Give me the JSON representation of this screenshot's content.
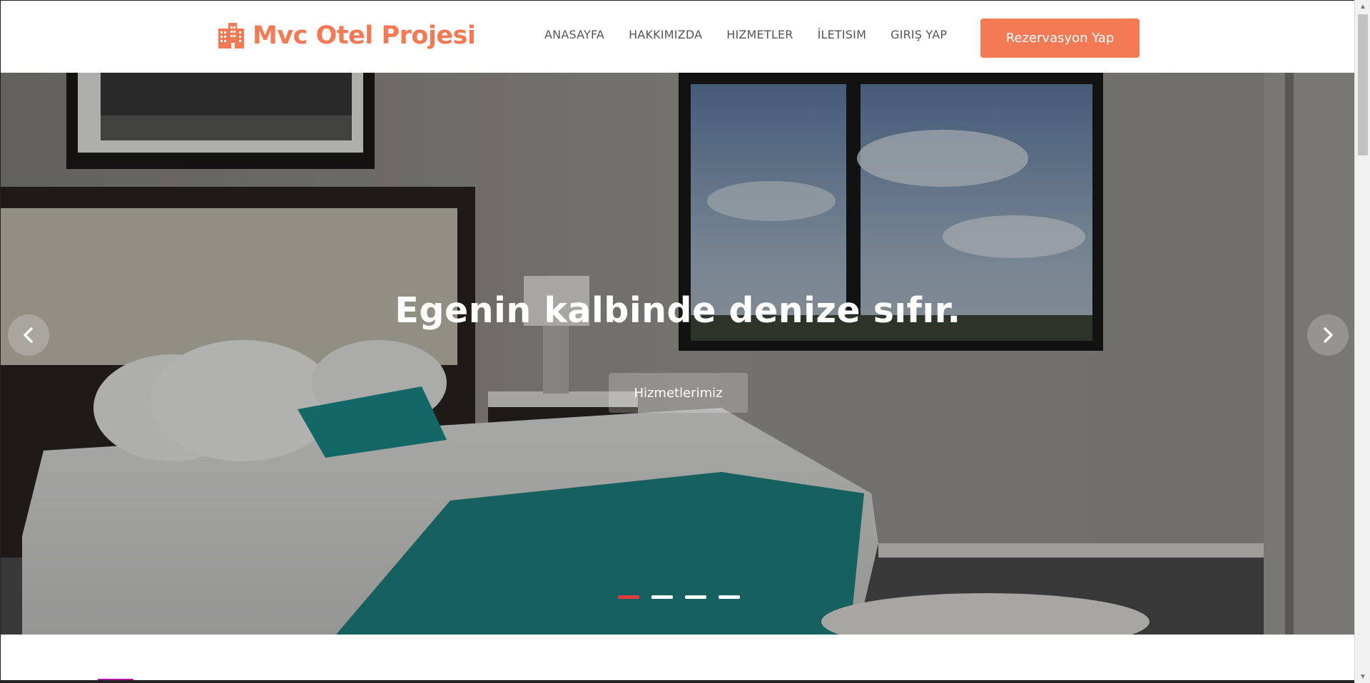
{
  "header": {
    "logo_text": "Mvc Otel Projesi",
    "logo_icon": "building-icon",
    "nav": [
      {
        "label": "ANASAYFA"
      },
      {
        "label": "HAKKIMIZDA"
      },
      {
        "label": "HIZMETLER"
      },
      {
        "label": "İLETISIM"
      },
      {
        "label": "GIRIŞ YAP"
      }
    ],
    "cta_label": "Rezervasyon Yap"
  },
  "hero": {
    "title": "Egenin kalbinde denize sıfır.",
    "button_label": "Hizmetlerimiz",
    "prev_icon": "chevron-left-icon",
    "next_icon": "chevron-right-icon",
    "slides_count": 4,
    "active_slide": 1
  },
  "colors": {
    "accent": "#f47a55",
    "indicator_active": "#e23b40"
  }
}
